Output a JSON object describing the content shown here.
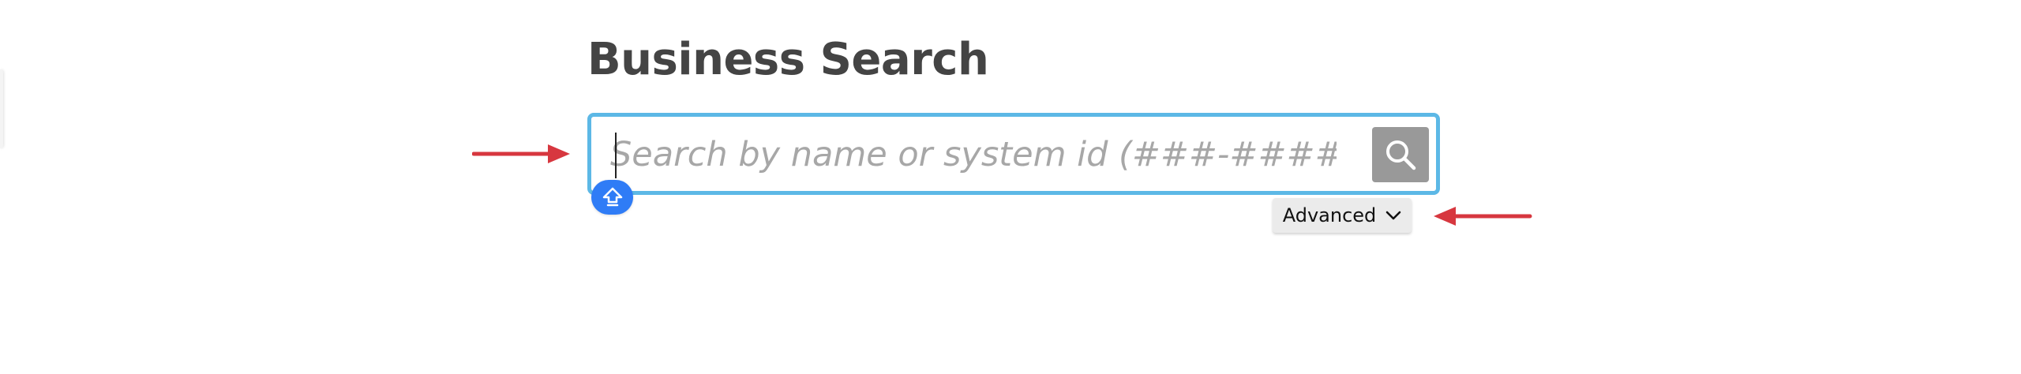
{
  "page": {
    "title": "Business Search"
  },
  "search": {
    "placeholder": "Search by name or system id (###-#####)",
    "value": "",
    "button_icon": "search-icon"
  },
  "advanced": {
    "label": "Advanced",
    "icon": "chevron-down-icon"
  },
  "annotations": {
    "arrow_color": "#d7373f",
    "badge_icon": "shift-arrow-icon",
    "input_focus_color": "#5cb8e6"
  }
}
